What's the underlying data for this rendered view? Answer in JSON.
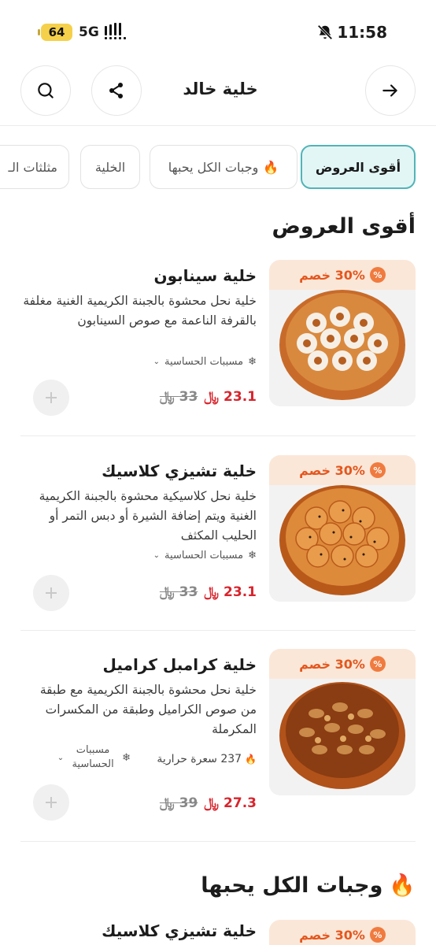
{
  "status_bar": {
    "battery": "64",
    "network": "5G",
    "time": "11:58"
  },
  "header": {
    "title": "خلية خالد"
  },
  "tabs": [
    {
      "label": "أقوى العروض",
      "active": true,
      "icon": ""
    },
    {
      "label": "وجبات الكل يحبها",
      "active": false,
      "icon": "🔥"
    },
    {
      "label": "الخلية",
      "active": false,
      "icon": ""
    },
    {
      "label": "مثلثات الـ",
      "active": false,
      "icon": ""
    }
  ],
  "sections": [
    {
      "title": "أقوى العروض",
      "icon": ""
    },
    {
      "title": "وجبات الكل يحبها",
      "icon": "🔥"
    }
  ],
  "products": [
    {
      "name": "خلية سينابون",
      "description": "خلية نحل محشوة بالجبنة الكريمية الغنية مغلفة بالقرفة الناعمة مع صوص السينابون",
      "discount": "30% خصم",
      "allergens": "مسببات الحساسية",
      "calories": "",
      "price_new": "23.1",
      "price_old": "33"
    },
    {
      "name": "خلية تشيزي كلاسيك",
      "description": "خلية نحل كلاسيكية محشوة بالجبنة الكريمية الغنية ويتم إضافة الشيرة أو دبس التمر أو الحليب المكثف",
      "discount": "30% خصم",
      "allergens": "مسببات الحساسية",
      "calories": "",
      "price_new": "23.1",
      "price_old": "33"
    },
    {
      "name": "خلية كرامبل كراميل",
      "description": "خلية نحل محشوة بالجبنة الكريمية مع طبقة من صوص الكراميل وطبقة من المكسرات المكرملة",
      "discount": "30% خصم",
      "allergens": "مسببات الحساسية",
      "calories": "237 سعرة حرارية",
      "price_new": "27.3",
      "price_old": "39"
    },
    {
      "name": "خلية تشيزي كلاسيك",
      "description": "",
      "discount": "30% خصم",
      "allergens": "",
      "calories": "",
      "price_new": "",
      "price_old": ""
    }
  ],
  "colors": {
    "accent": "#52b4b8",
    "accent_bg": "#e3f6f6",
    "discount_text": "#e4571e",
    "discount_bg": "#fbe7d8",
    "price_new": "#d8252d"
  }
}
